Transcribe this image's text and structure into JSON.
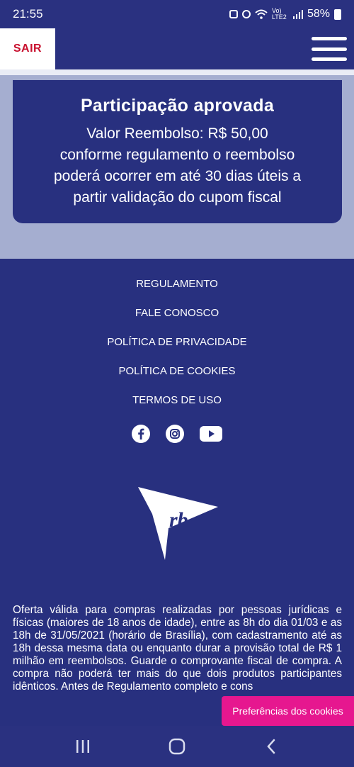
{
  "status_bar": {
    "time": "21:55",
    "network_label": "Vo) LTE2",
    "battery": "58%",
    "icons": [
      "alarm-icon",
      "notification-icon",
      "wifi-icon",
      "signal-icon",
      "battery-icon"
    ]
  },
  "header": {
    "logout_label": "SAIR",
    "menu_icon": "hamburger-icon"
  },
  "approval": {
    "title": "Participação aprovada",
    "line1": "Valor Reembolso: R$ 50,00",
    "line2": "conforme regulamento o reembolso",
    "line3": "poderá ocorrer em até 30 dias úteis a",
    "line4": "partir validação do cupom fiscal"
  },
  "footer": {
    "links": [
      "REGULAMENTO",
      "FALE CONOSCO",
      "POLÍTICA DE PRIVACIDADE",
      "POLÍTICA DE COOKIES",
      "TERMOS DE USO"
    ],
    "social_icons": [
      "facebook-icon",
      "instagram-icon",
      "youtube-icon"
    ],
    "logo_text": "rb",
    "legal_text": "Oferta válida para compras realizadas por pessoas jurídicas e físicas (maiores de 18 anos de idade), entre as 8h do dia 01/03 e as 18h de 31/05/2021 (horário de Brasília), com cadastramento até as 18h dessa mesma data ou enquanto durar a provisão total de R$ 1 milhão em reembolsos. Guarde o comprovante fiscal de compra. A compra não poderá ter mais do que dois produtos participantes idênticos. Antes de Regulamento completo e cons"
  },
  "cookie_button": "Preferências dos cookies",
  "navbar": {
    "icons": [
      "recent-apps-icon",
      "home-icon",
      "back-icon"
    ]
  },
  "colors": {
    "brand_blue": "#28307f",
    "accent_red": "#c8102e",
    "cookie_pink": "#e6178f",
    "hero_bg": "#a5aed0"
  }
}
